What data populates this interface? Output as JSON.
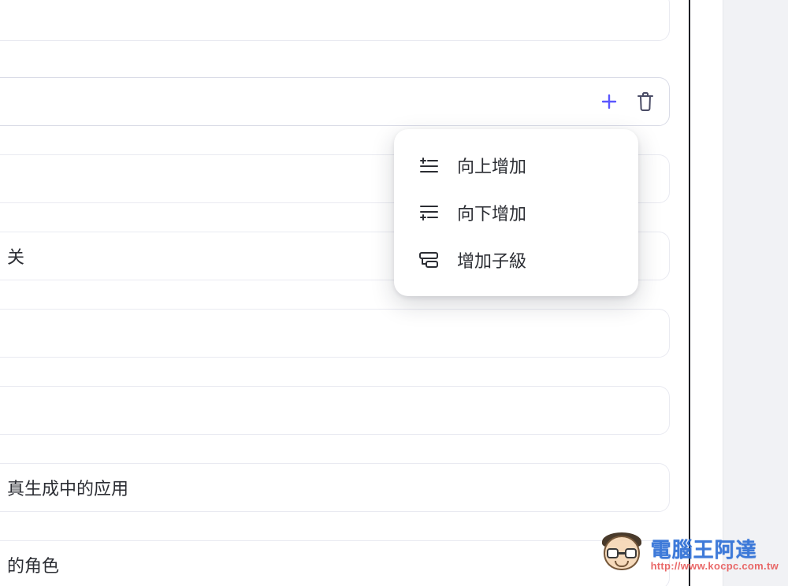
{
  "rows": {
    "r0": {
      "text": ""
    },
    "r1": {
      "text": ""
    },
    "r2": {
      "text": ""
    },
    "r3": {
      "text": "关"
    },
    "r4": {
      "text": ""
    },
    "r5": {
      "text": ""
    },
    "r6": {
      "text": "真生成中的应用"
    },
    "r7": {
      "text": "的角色"
    }
  },
  "menu": {
    "add_above": "向上增加",
    "add_below": "向下增加",
    "add_child": "增加子級"
  },
  "watermark": {
    "title": "電腦王阿達",
    "url": "http://www.kocpc.com.tw"
  }
}
